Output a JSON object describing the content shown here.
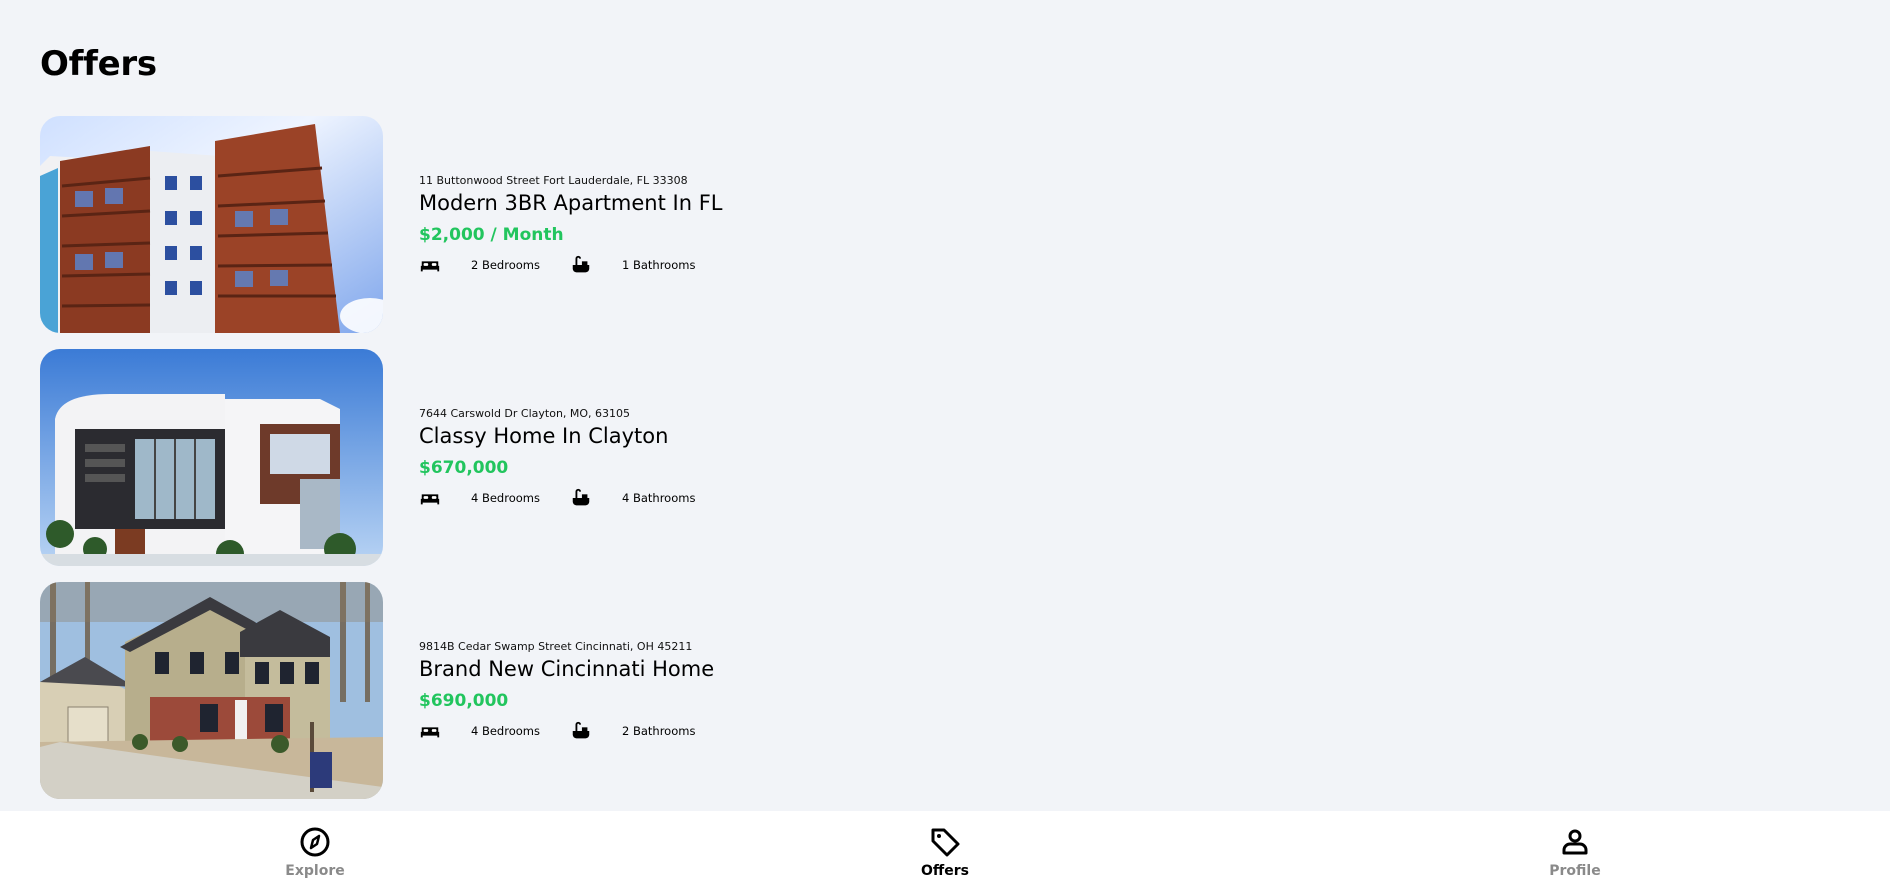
{
  "header": {
    "title": "Offers"
  },
  "listings": [
    {
      "address": "11 Buttonwood Street Fort Lauderdale, FL 33308",
      "name": "Modern 3BR Apartment In FL",
      "price": "$2,000 / Month",
      "bedrooms": "2 Bedrooms",
      "bathrooms": "1 Bathrooms",
      "photo_icon": "apartment-building-photo"
    },
    {
      "address": "7644 Carswold Dr Clayton, MO, 63105",
      "name": "Classy Home In Clayton",
      "price": "$670,000",
      "bedrooms": "4 Bedrooms",
      "bathrooms": "4 Bathrooms",
      "photo_icon": "modern-house-photo"
    },
    {
      "address": "9814B Cedar Swamp Street Cincinnati, OH 45211",
      "name": "Brand New Cincinnati Home",
      "price": "$690,000",
      "bedrooms": "4 Bedrooms",
      "bathrooms": "2 Bathrooms",
      "photo_icon": "suburban-house-photo"
    }
  ],
  "nav": {
    "items": [
      {
        "label": "Explore",
        "icon": "compass-icon",
        "active": false
      },
      {
        "label": "Offers",
        "icon": "tag-icon",
        "active": true
      },
      {
        "label": "Profile",
        "icon": "person-icon",
        "active": false
      }
    ]
  },
  "colors": {
    "background": "#f2f4f8",
    "price": "#22c55e",
    "nav_inactive": "#8a8a8a",
    "nav_active": "#000000"
  }
}
